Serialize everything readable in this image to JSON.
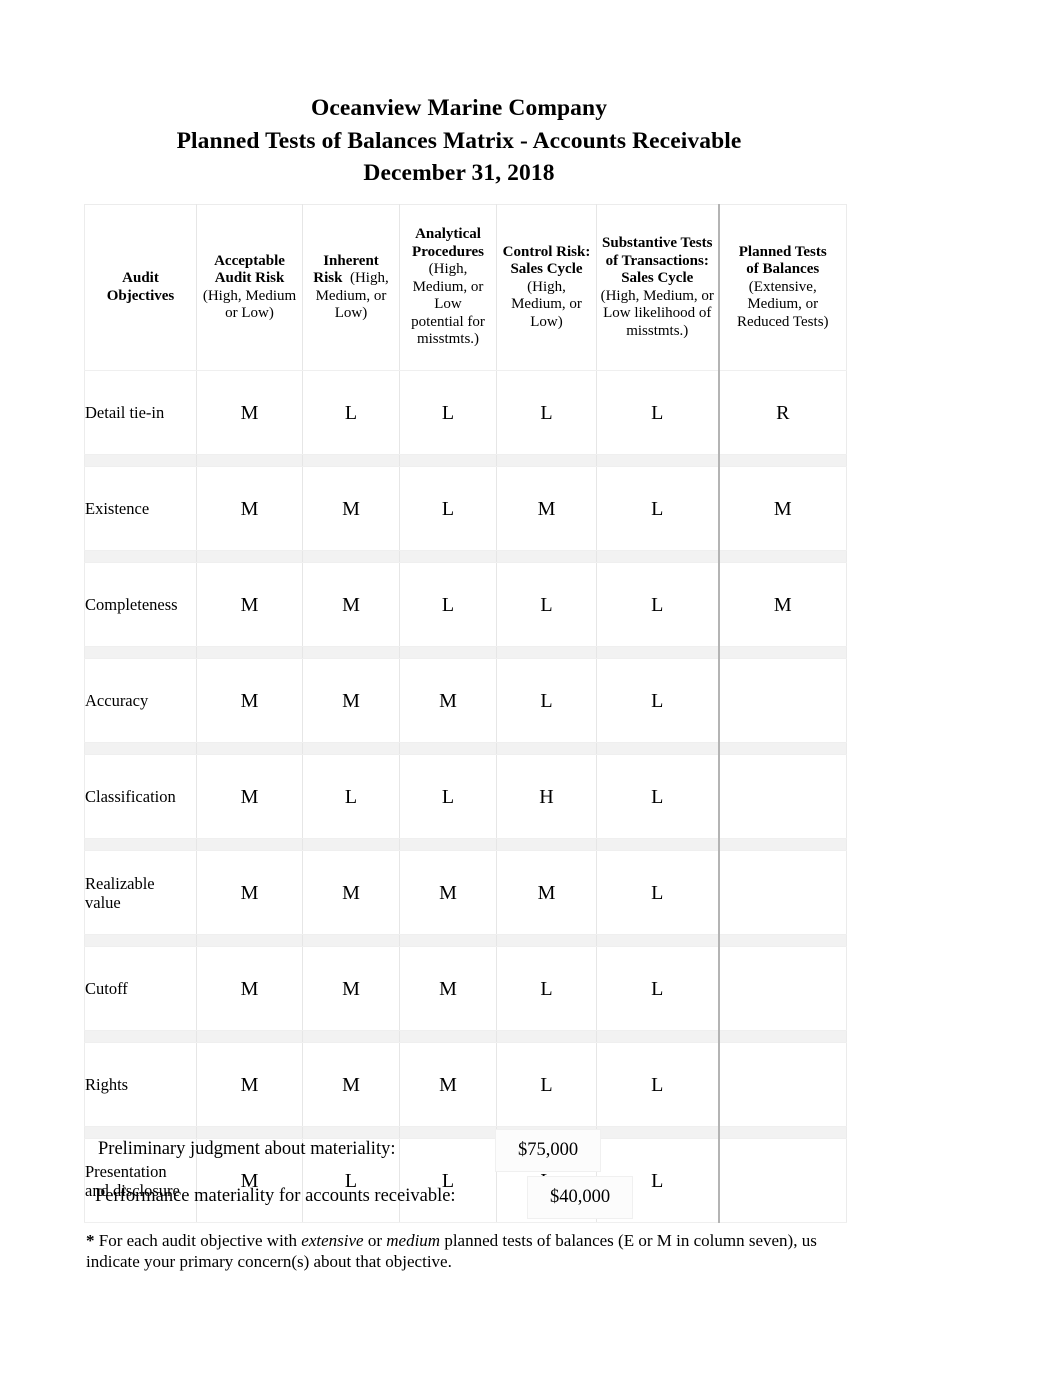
{
  "document": {
    "title_lines": [
      "Oceanview Marine Company",
      "Planned Tests of Balances Matrix - Accounts Receivable",
      "December 31, 2018"
    ]
  },
  "matrix": {
    "headers": [
      {
        "bold": "Audit\nObjectives",
        "sub": ""
      },
      {
        "bold": "Acceptable\nAudit Risk",
        "sub": "(High, Medium\nor Low)"
      },
      {
        "bold": "Inherent\nRisk",
        "sub": "(High,\nMedium, or\nLow)"
      },
      {
        "bold": "Analytical\nProcedures",
        "sub": "(High,\nMedium, or\nLow\npotential for\nmisstmts.)"
      },
      {
        "bold": "Control Risk:\nSales Cycle",
        "sub": "(High,\nMedium, or\nLow)"
      },
      {
        "bold": "Substantive Tests\nof Transactions:\nSales Cycle",
        "sub": "(High, Medium, or\nLow likelihood of\nmisstmts.)"
      },
      {
        "bold": "Planned Tests\nof Balances",
        "sub": "(Extensive,\nMedium, or\nReduced Tests)"
      }
    ],
    "header_texts": {
      "h1_bold_l1": "Audit",
      "h1_bold_l2": "Objectives",
      "h2_bold_l1": "Acceptable",
      "h2_bold_l2": "Audit Risk",
      "h2_sub_l1": "(High, Medium",
      "h2_sub_l2": "or Low)",
      "h3_bold_l1": "Inherent",
      "h3_bold_l2": "Risk",
      "h3_sub_l1": "(High,",
      "h3_sub_l2": "Medium, or",
      "h3_sub_l3": "Low)",
      "h4_bold_l1": "Analytical",
      "h4_bold_l2": "Procedures",
      "h4_sub_l1": "(High,",
      "h4_sub_l2": "Medium, or",
      "h4_sub_l3": "Low",
      "h4_sub_l4": "potential for",
      "h4_sub_l5": "misstmts.)",
      "h5_bold_l1": "Control Risk:",
      "h5_bold_l2": "Sales Cycle",
      "h5_sub_l1": "(High,",
      "h5_sub_l2": "Medium, or",
      "h5_sub_l3": "Low)",
      "h6_bold_l1": "Substantive Tests",
      "h6_bold_l2": "of Transactions:",
      "h6_bold_l3": "Sales Cycle",
      "h6_sub_l1": "(High, Medium, or",
      "h6_sub_l2": "Low likelihood of",
      "h6_sub_l3": "misstmts.)",
      "h7_bold_l1": "Planned Tests",
      "h7_bold_l2": "of Balances",
      "h7_sub_l1": "(Extensive,",
      "h7_sub_l2": "Medium, or",
      "h7_sub_l3": "Reduced Tests)"
    },
    "rows": [
      {
        "objective": "Detail tie-in",
        "acceptable_audit_risk": "M",
        "inherent_risk": "L",
        "analytical_procedures": "L",
        "control_risk": "L",
        "substantive_tests": "L",
        "planned_tests": "R"
      },
      {
        "objective": "Existence",
        "acceptable_audit_risk": "M",
        "inherent_risk": "M",
        "analytical_procedures": "L",
        "control_risk": "M",
        "substantive_tests": "L",
        "planned_tests": "M"
      },
      {
        "objective": "Completeness",
        "acceptable_audit_risk": "M",
        "inherent_risk": "M",
        "analytical_procedures": "L",
        "control_risk": "L",
        "substantive_tests": "L",
        "planned_tests": "M"
      },
      {
        "objective": "Accuracy",
        "acceptable_audit_risk": "M",
        "inherent_risk": "M",
        "analytical_procedures": "M",
        "control_risk": "L",
        "substantive_tests": "L",
        "planned_tests": ""
      },
      {
        "objective": "Classification",
        "acceptable_audit_risk": "M",
        "inherent_risk": "L",
        "analytical_procedures": "L",
        "control_risk": "H",
        "substantive_tests": "L",
        "planned_tests": ""
      },
      {
        "objective": "Realizable value",
        "objective_l1": "Realizable",
        "objective_l2": "value",
        "acceptable_audit_risk": "M",
        "inherent_risk": "M",
        "analytical_procedures": "M",
        "control_risk": "M",
        "substantive_tests": "L",
        "planned_tests": ""
      },
      {
        "objective": "Cutoff",
        "acceptable_audit_risk": "M",
        "inherent_risk": "M",
        "analytical_procedures": "M",
        "control_risk": "L",
        "substantive_tests": "L",
        "planned_tests": ""
      },
      {
        "objective": "Rights",
        "acceptable_audit_risk": "M",
        "inherent_risk": "M",
        "analytical_procedures": "M",
        "control_risk": "L",
        "substantive_tests": "L",
        "planned_tests": ""
      },
      {
        "objective": "Presentation and disclosure",
        "objective_l1": "Presentation",
        "objective_l2": "and disclosure",
        "acceptable_audit_risk": "M",
        "inherent_risk": "L",
        "analytical_procedures": "L",
        "control_risk": "L",
        "substantive_tests": "L",
        "planned_tests": ""
      }
    ]
  },
  "materiality": {
    "preliminary_label": "Preliminary judgment about materiality:",
    "preliminary_value": "$75,000",
    "performance_label": "Performance materiality for accounts receivable:",
    "performance_value": "$40,000"
  },
  "footnote": {
    "marker": "*",
    "part1": " For each audit objective with ",
    "italic1": "extensive",
    "part2": " or ",
    "italic2": "medium",
    "part3": " planned tests of balances (E or M in column seven), us",
    "line2": "indicate your primary concern(s) about that objective."
  }
}
